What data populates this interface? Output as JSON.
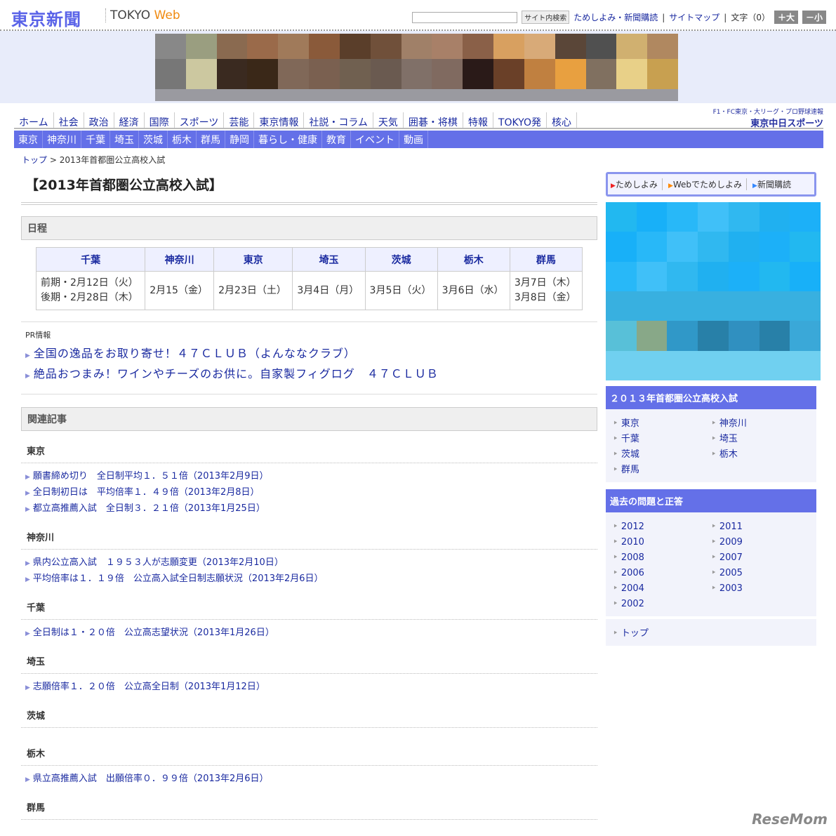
{
  "header": {
    "logo": "東京新聞",
    "logo_tokyo": "TOKYO ",
    "logo_web": "Web",
    "search_placeholder": "",
    "search_button": "サイト内検索",
    "link1": "ためしよみ・新聞購読",
    "link2": "サイトマップ",
    "text_size_label": "文字（0）",
    "bigger": "＋大",
    "smaller": "－小"
  },
  "nav1": [
    "ホーム",
    "社会",
    "政治",
    "経済",
    "国際",
    "スポーツ",
    "芸能",
    "東京情報",
    "社説・コラム",
    "天気",
    "囲碁・将棋",
    "特報",
    "TOKYO発",
    "核心"
  ],
  "chunichi": {
    "sub": "F1・FC東京・大リーグ・プロ野球速報",
    "name": "東京中日スポーツ"
  },
  "nav2": [
    "東京",
    "神奈川",
    "千葉",
    "埼玉",
    "茨城",
    "栃木",
    "群馬",
    "静岡",
    "暮らし・健康",
    "教育",
    "イベント",
    "動画"
  ],
  "breadcrumb": {
    "top": "トップ",
    "sep": " > ",
    "current": "2013年首都圏公立高校入試"
  },
  "title": "【2013年首都圏公立高校入試】",
  "schedule": {
    "heading": "日程",
    "headers": [
      "千葉",
      "神奈川",
      "東京",
      "埼玉",
      "茨城",
      "栃木",
      "群馬"
    ],
    "cells": [
      "前期・2月12日（火）\n後期・2月28日（木）",
      "2月15（金）",
      "2月23日（土）",
      "3月4日（月）",
      "3月5日（火）",
      "3月6日（水）",
      "3月7日（木）\n3月8日（金）"
    ]
  },
  "pr": {
    "label": "PR情報",
    "links": [
      "全国の逸品をお取り寄せ！４７ＣＬＵＢ（よんななクラブ）",
      "絶品おつまみ！ワインやチーズのお供に。自家製フィグログ　４７ＣＬＵＢ"
    ]
  },
  "related": {
    "heading": "関連記事",
    "groups": [
      {
        "name": "東京",
        "links": [
          "願書締め切り　全日制平均１．５１倍（2013年2月9日）",
          "全日制初日は　平均倍率１．４９倍（2013年2月8日）",
          "都立高推薦入試　全日制３．２１倍（2013年1月25日）"
        ]
      },
      {
        "name": "神奈川",
        "links": [
          "県内公立高入試　１９５３人が志願変更（2013年2月10日）",
          "平均倍率は１．１９倍　公立高入試全日制志願状況（2013年2月6日）"
        ]
      },
      {
        "name": "千葉",
        "links": [
          "全日制は１・２０倍　公立高志望状況（2013年1月26日）"
        ]
      },
      {
        "name": "埼玉",
        "links": [
          "志願倍率１．２０倍　公立高全日制（2013年1月12日）"
        ]
      },
      {
        "name": "茨城",
        "links": []
      },
      {
        "name": "栃木",
        "links": [
          "県立高推薦入試　出願倍率０．９９倍（2013年2月6日）"
        ]
      },
      {
        "name": "群馬",
        "links": []
      }
    ]
  },
  "side": {
    "trial": [
      "ためしよみ",
      "Webでためしよみ",
      "新聞購読"
    ],
    "box1": {
      "title": "２０１３年首都圏公立高校入試",
      "items": [
        "東京",
        "神奈川",
        "千葉",
        "埼玉",
        "茨城",
        "栃木",
        "群馬"
      ]
    },
    "box2": {
      "title": "過去の問題と正答",
      "items": [
        "2012",
        "2011",
        "2010",
        "2009",
        "2008",
        "2007",
        "2006",
        "2005",
        "2004",
        "2003",
        "2002"
      ]
    },
    "top": "トップ"
  },
  "watermark": "ReseMom"
}
